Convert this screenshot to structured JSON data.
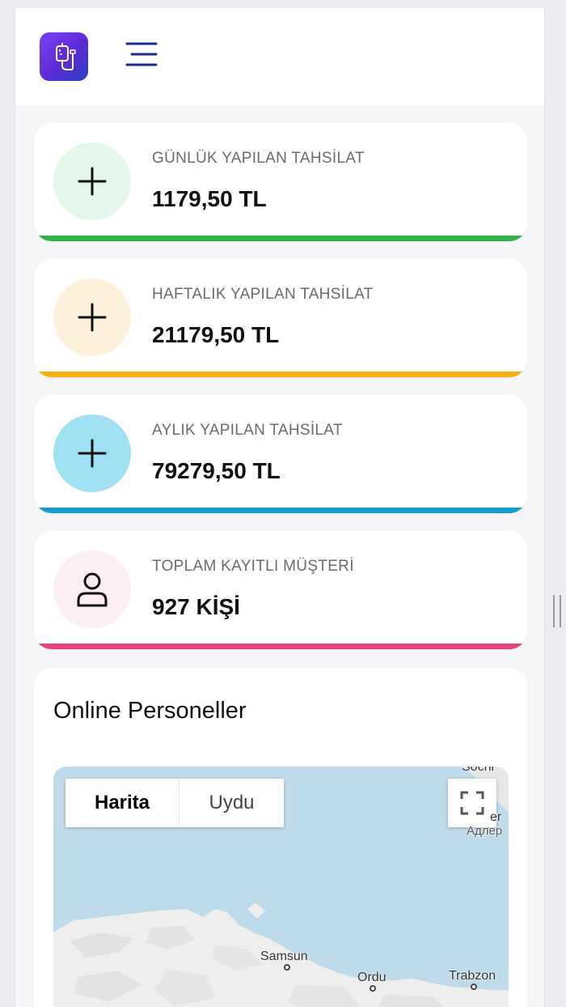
{
  "stats": [
    {
      "label": "GÜNLÜK YAPILAN TAHSİLAT",
      "value": "1179,50 TL",
      "icon": "plus-icon",
      "circle_color": "#e3f7ea",
      "bar_color": "#2db34a"
    },
    {
      "label": "HAFTALIK YAPILAN TAHSİLAT",
      "value": "21179,50 TL",
      "icon": "plus-icon",
      "circle_color": "#fdf1dc",
      "bar_color": "#f5b00e"
    },
    {
      "label": "AYLIK YAPILAN TAHSİLAT",
      "value": "79279,50 TL",
      "icon": "plus-icon",
      "circle_color": "#9fe0f2",
      "bar_color": "#149ccc"
    },
    {
      "label": "TOPLAM KAYITLI MÜŞTERİ",
      "value": "927 KİŞİ",
      "icon": "user-icon",
      "circle_color": "#fdeef3",
      "bar_color": "#e7407e"
    }
  ],
  "online": {
    "title": "Online Personeller",
    "map": {
      "tabs": [
        "Harita",
        "Uydu"
      ],
      "labels": {
        "sochi": "Sochi",
        "adler_partial": "er",
        "adler_ru": "Адлер",
        "samsun": "Samsun",
        "ordu": "Ordu",
        "trabzon": "Trabzon"
      }
    }
  },
  "colors": {
    "accent": "#5d2bd6",
    "menu": "#1d2a8f",
    "sea": "#bedbec",
    "land": "#efefef"
  }
}
